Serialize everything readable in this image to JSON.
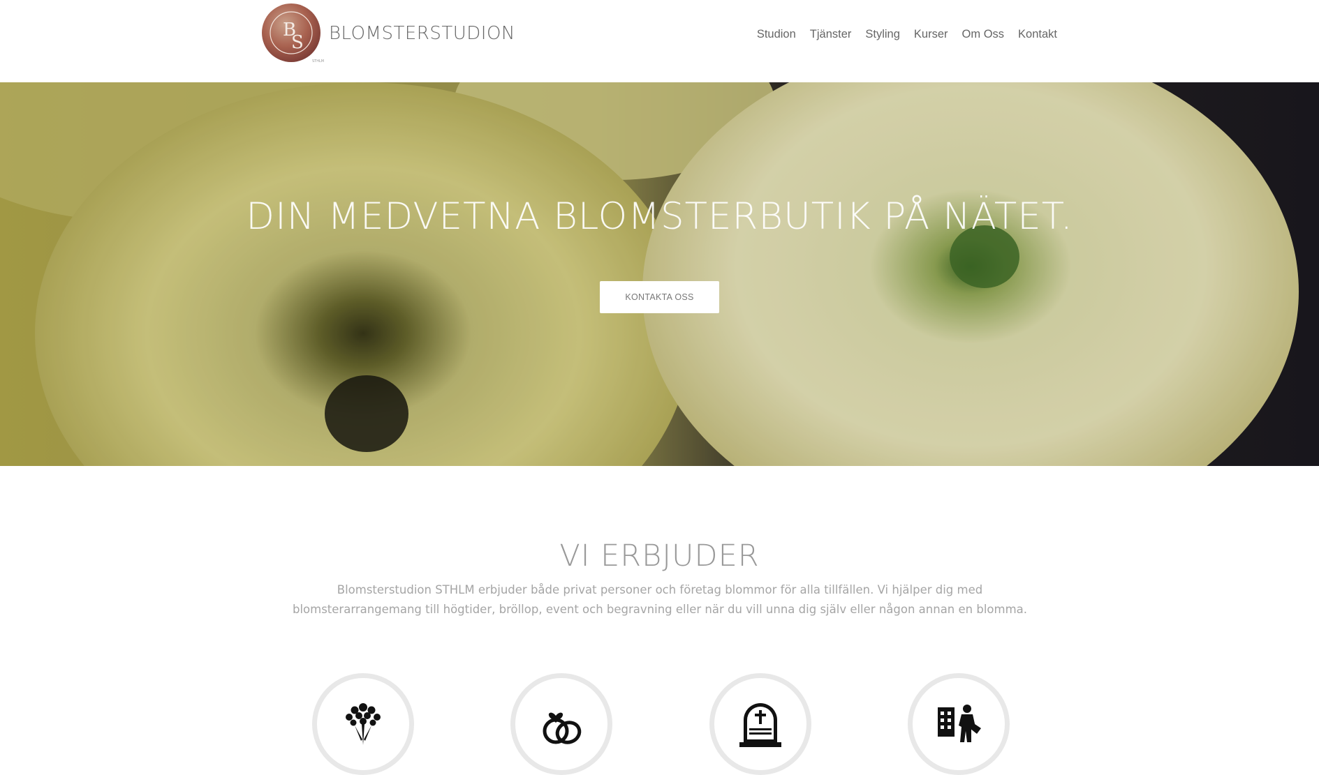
{
  "header": {
    "logo_text": "BS",
    "brand": "BLOMSTERSTUDION",
    "nav": [
      {
        "label": "Studion"
      },
      {
        "label": "Tjänster"
      },
      {
        "label": "Styling"
      },
      {
        "label": "Kurser"
      },
      {
        "label": "Om Oss"
      },
      {
        "label": "Kontakt"
      }
    ]
  },
  "hero": {
    "title": "DIN MEDVETNA BLOMSTERBUTIK PÅ NÄTET.",
    "button": "KONTAKTA OSS"
  },
  "offer": {
    "title": "VI ERBJUDER",
    "text": "Blomsterstudion STHLM erbjuder både privat personer och företag blommor för alla tillfällen. Vi hjälper dig med blomsterarrangemang till högtider, bröllop, event och begravning eller när du vill unna dig själv eller någon annan en blomma."
  },
  "services": [
    {
      "icon": "bouquet-icon"
    },
    {
      "icon": "wedding-rings-icon"
    },
    {
      "icon": "gravestone-icon"
    },
    {
      "icon": "business-icon"
    }
  ],
  "colors": {
    "text_gray": "#666666",
    "light_gray": "#a5a5a5",
    "circle_border": "#e8e8e8"
  }
}
